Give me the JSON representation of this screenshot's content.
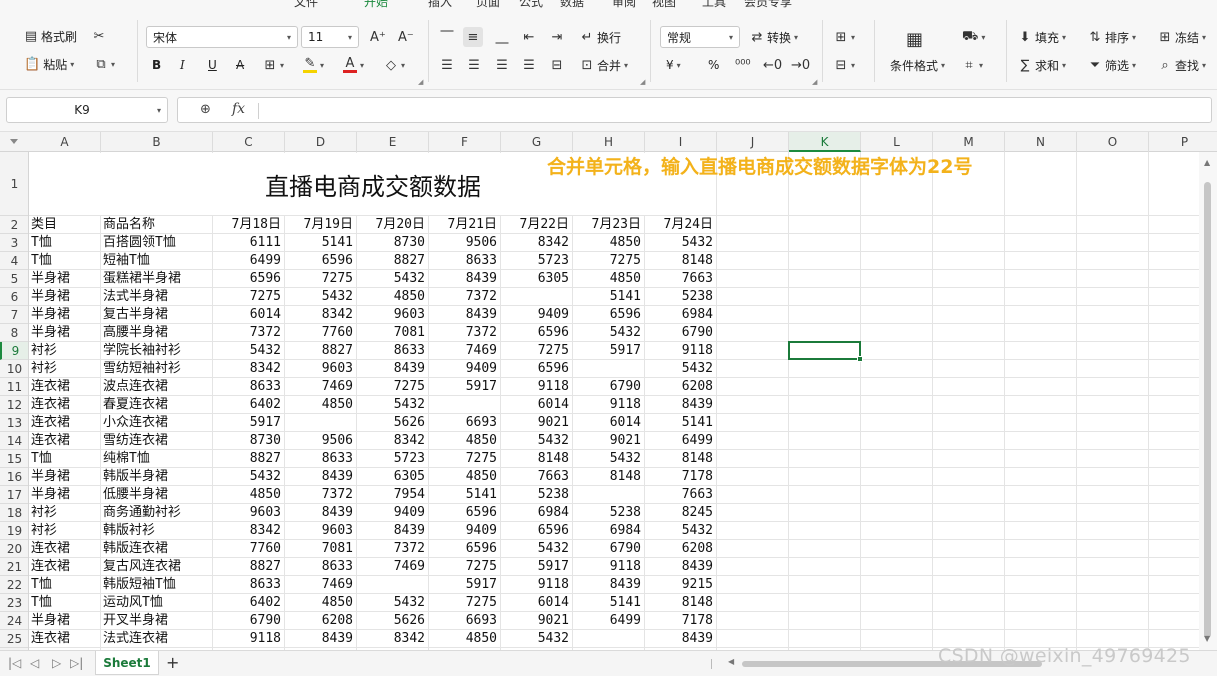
{
  "menu": {
    "items": [
      "文件",
      "开始",
      "插入",
      "页面",
      "公式",
      "数据",
      "审阅",
      "视图",
      "工具",
      "会员专享"
    ],
    "active_index": 1
  },
  "ribbon": {
    "format_painter": "格式刷",
    "paste": "粘贴",
    "font_name": "宋体",
    "font_size": "11",
    "bold": "B",
    "italic": "I",
    "underline": "U",
    "strike": "A",
    "wrap_text": "换行",
    "merge": "合并",
    "number_format": "常规",
    "convert": "转换",
    "currency": "¥",
    "percent": "%",
    "conditional_format": "条件格式",
    "fill": "填充",
    "sort": "排序",
    "freeze": "冻结",
    "sum": "求和",
    "filter": "筛选",
    "find": "查找"
  },
  "formula_bar": {
    "name_box": "K9",
    "fx": "fx",
    "formula": ""
  },
  "columns": [
    "A",
    "B",
    "C",
    "D",
    "E",
    "F",
    "G",
    "H",
    "I",
    "J",
    "K",
    "L",
    "M",
    "N",
    "O",
    "P"
  ],
  "active_column": "K",
  "active_row": "9",
  "sheet": {
    "title": "直播电商成交额数据",
    "note": "合并单元格，输入直播电商成交额数据字体为22号",
    "header": [
      "类目",
      "商品名称",
      "7月18日",
      "7月19日",
      "7月20日",
      "7月21日",
      "7月22日",
      "7月23日",
      "7月24日"
    ],
    "rows": [
      [
        "T恤",
        "百搭圆领T恤",
        "6111",
        "5141",
        "8730",
        "9506",
        "8342",
        "4850",
        "5432"
      ],
      [
        "T恤",
        "短袖T恤",
        "6499",
        "6596",
        "8827",
        "8633",
        "5723",
        "7275",
        "8148"
      ],
      [
        "半身裙",
        "蛋糕裙半身裙",
        "6596",
        "7275",
        "5432",
        "8439",
        "6305",
        "4850",
        "7663"
      ],
      [
        "半身裙",
        "法式半身裙",
        "7275",
        "5432",
        "4850",
        "7372",
        "",
        "5141",
        "5238"
      ],
      [
        "半身裙",
        "复古半身裙",
        "6014",
        "8342",
        "9603",
        "8439",
        "9409",
        "6596",
        "6984"
      ],
      [
        "半身裙",
        "高腰半身裙",
        "7372",
        "7760",
        "7081",
        "7372",
        "6596",
        "5432",
        "6790"
      ],
      [
        "衬衫",
        "学院长袖衬衫",
        "5432",
        "8827",
        "8633",
        "7469",
        "7275",
        "5917",
        "9118"
      ],
      [
        "衬衫",
        "雪纺短袖衬衫",
        "8342",
        "9603",
        "8439",
        "9409",
        "6596",
        "",
        "5432"
      ],
      [
        "连衣裙",
        "波点连衣裙",
        "8633",
        "7469",
        "7275",
        "5917",
        "9118",
        "6790",
        "6208"
      ],
      [
        "连衣裙",
        "春夏连衣裙",
        "6402",
        "4850",
        "5432",
        "",
        "6014",
        "9118",
        "8439"
      ],
      [
        "连衣裙",
        "小众连衣裙",
        "5917",
        "",
        "5626",
        "6693",
        "9021",
        "6014",
        "5141"
      ],
      [
        "连衣裙",
        "雪纺连衣裙",
        "8730",
        "9506",
        "8342",
        "4850",
        "5432",
        "9021",
        "6499"
      ],
      [
        "T恤",
        "纯棉T恤",
        "8827",
        "8633",
        "5723",
        "7275",
        "8148",
        "5432",
        "8148"
      ],
      [
        "半身裙",
        "韩版半身裙",
        "5432",
        "8439",
        "6305",
        "4850",
        "7663",
        "8148",
        "7178"
      ],
      [
        "半身裙",
        "低腰半身裙",
        "4850",
        "7372",
        "7954",
        "5141",
        "5238",
        "",
        "7663"
      ],
      [
        "衬衫",
        "商务通勤衬衫",
        "9603",
        "8439",
        "9409",
        "6596",
        "6984",
        "5238",
        "8245"
      ],
      [
        "衬衫",
        "韩版衬衫",
        "8342",
        "9603",
        "8439",
        "9409",
        "6596",
        "6984",
        "5432"
      ],
      [
        "连衣裙",
        "韩版连衣裙",
        "7760",
        "7081",
        "7372",
        "6596",
        "5432",
        "6790",
        "6208"
      ],
      [
        "连衣裙",
        "复古风连衣裙",
        "8827",
        "8633",
        "7469",
        "7275",
        "5917",
        "9118",
        "8439"
      ],
      [
        "T恤",
        "韩版短袖T恤",
        "8633",
        "7469",
        "",
        "5917",
        "9118",
        "8439",
        "9215"
      ],
      [
        "T恤",
        "运动风T恤",
        "6402",
        "4850",
        "5432",
        "7275",
        "6014",
        "5141",
        "8148"
      ],
      [
        "半身裙",
        "开叉半身裙",
        "6790",
        "6208",
        "5626",
        "6693",
        "9021",
        "6499",
        "7178"
      ],
      [
        "连衣裙",
        "法式连衣裙",
        "9118",
        "8439",
        "8342",
        "4850",
        "5432",
        "",
        "8439"
      ]
    ]
  },
  "row_numbers": [
    "1",
    "2",
    "3",
    "4",
    "5",
    "6",
    "7",
    "8",
    "9",
    "10",
    "11",
    "12",
    "13",
    "14",
    "15",
    "16",
    "17",
    "18",
    "19",
    "20",
    "21",
    "22",
    "23",
    "24",
    "25"
  ],
  "bottom": {
    "sheet_tab": "Sheet1",
    "add_tab": "+"
  },
  "watermark": "CSDN @weixin_49769425"
}
